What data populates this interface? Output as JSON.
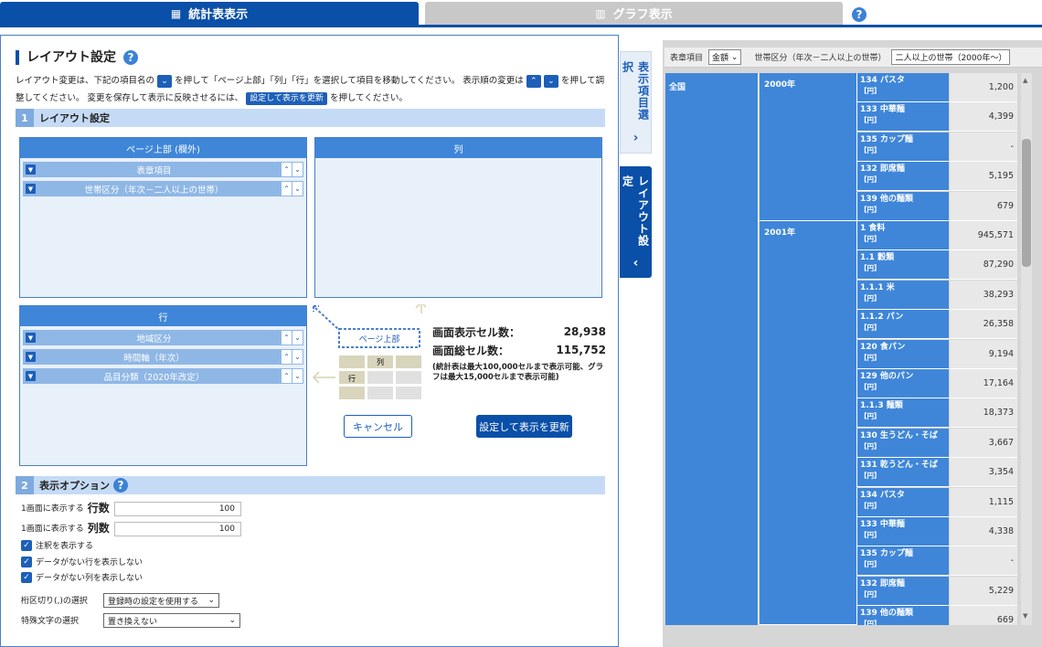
{
  "tabs": {
    "stat_label": "統計表表示",
    "graph_label": "グラフ表示"
  },
  "layout": {
    "title": "レイアウト設定",
    "desc_parts": {
      "p1": "レイアウト変更は、下記の項目名の",
      "p2": "を押して「ページ上部」「列」「行」を選択して項目を移動してください。 表示順の変更は",
      "p3": "を押して調整してください。 変更を保存して表示に反映させるには、",
      "p4": "を押してください。",
      "chip_apply": "設定して表示を更新"
    },
    "section1": {
      "num": "1",
      "label": "レイアウト設定"
    },
    "page_top": {
      "header": "ページ上部 (欄外)",
      "items": [
        "表章項目",
        "世帯区分（年次－二人以上の世帯）"
      ]
    },
    "columns": {
      "header": "列"
    },
    "rows": {
      "header": "行",
      "items": [
        "地域区分",
        "時間軸（年次）",
        "品目分類（2020年改定）"
      ]
    },
    "diagram": {
      "page_top": "ページ上部",
      "col": "列",
      "row": "行"
    },
    "stats": {
      "display_cells_label": "画面表示セル数：",
      "display_cells_value": "28,938",
      "total_cells_label": "画面総セル数：",
      "total_cells_value": "115,752",
      "note": "(統計表は最大100,000セルまで表示可能、グラフは最大15,000セルまで表示可能)"
    },
    "cancel": "キャンセル",
    "apply": "設定して表示を更新"
  },
  "options": {
    "section": {
      "num": "2",
      "label": "表示オプション"
    },
    "rows_per_page_prefix": "1画面に表示する",
    "rows_per_page_big": "行数",
    "rows_per_page_value": "100",
    "cols_per_page_prefix": "1画面に表示する",
    "cols_per_page_big": "列数",
    "cols_per_page_value": "100",
    "checkboxes": [
      "注釈を表示する",
      "データがない行を表示しない",
      "データがない列を表示しない"
    ],
    "separator_label": "桁区切り(,)の選択",
    "separator_value": "登録時の設定を使用する",
    "special_label": "特殊文字の選択",
    "special_value": "置き換えない"
  },
  "side_tabs": {
    "item_select": "表示項目選択",
    "layout": "レイアウト設定"
  },
  "table": {
    "header": {
      "item_label": "表章項目",
      "item_value": "金額",
      "household_label": "世帯区分（年次－二人以上の世帯）",
      "household_value": "二人以上の世帯（2000年～）"
    },
    "region": "全国",
    "years": [
      "2000年",
      "2001年"
    ],
    "unit": "【円】",
    "rows": [
      {
        "name": "134 パスタ",
        "value": "1,200"
      },
      {
        "name": "133 中華麺",
        "value": "4,399"
      },
      {
        "name": "135 カップ麺",
        "value": "-"
      },
      {
        "name": "132 即席麺",
        "value": "5,195"
      },
      {
        "name": "139 他の麺類",
        "value": "679"
      },
      {
        "name": "1 食料",
        "value": "945,571"
      },
      {
        "name": "1.1 穀類",
        "value": "87,290"
      },
      {
        "name": "1.1.1 米",
        "value": "38,293"
      },
      {
        "name": "1.1.2 パン",
        "value": "26,358"
      },
      {
        "name": "120 食パン",
        "value": "9,194"
      },
      {
        "name": "129 他のパン",
        "value": "17,164"
      },
      {
        "name": "1.1.3 麺類",
        "value": "18,373"
      },
      {
        "name": "130 生うどん・そば",
        "value": "3,667"
      },
      {
        "name": "131 乾うどん・そば",
        "value": "3,354"
      },
      {
        "name": "134 パスタ",
        "value": "1,115"
      },
      {
        "name": "133 中華麺",
        "value": "4,338"
      },
      {
        "name": "135 カップ麺",
        "value": "-"
      },
      {
        "name": "132 即席麺",
        "value": "5,229"
      },
      {
        "name": "139 他の麺類",
        "value": "669"
      }
    ]
  },
  "colors": {
    "primary": "#0a4fa8",
    "cell_blue": "#3f86d9",
    "accent_light": "#c5dbf5"
  }
}
